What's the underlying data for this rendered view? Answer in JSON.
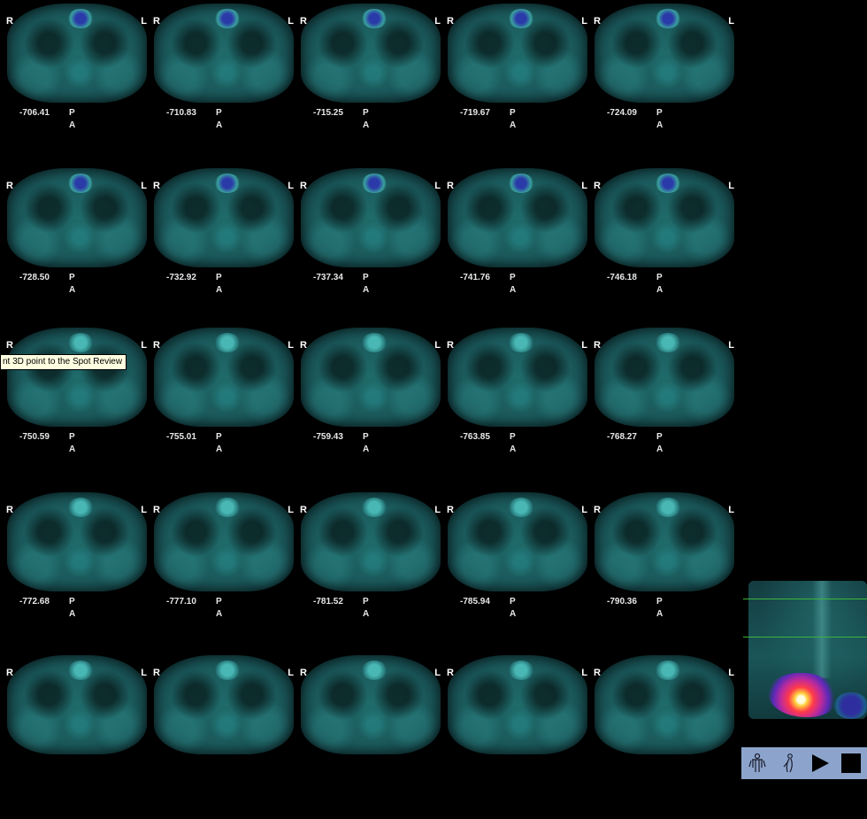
{
  "orientation": {
    "right": "R",
    "left": "L",
    "posterior": "P",
    "anterior": "A"
  },
  "slices": [
    "-706.41",
    "-710.83",
    "-715.25",
    "-719.67",
    "-724.09",
    "-728.50",
    "-732.92",
    "-737.34",
    "-741.76",
    "-746.18",
    "-750.59",
    "-755.01",
    "-759.43",
    "-763.85",
    "-768.27",
    "-772.68",
    "-777.10",
    "-781.52",
    "-785.94",
    "-790.36",
    "",
    "",
    "",
    "",
    ""
  ],
  "tooltip": {
    "text": "nt 3D point to the Spot Review"
  },
  "toolbar": {
    "buttons": [
      "body-front-icon",
      "body-side-icon",
      "play-icon",
      "stop-icon"
    ]
  },
  "colors": {
    "scan_accent": "#1f6a6a",
    "slice_line": "#3cb43c",
    "toolbar_bg": "#8ca4cc"
  }
}
